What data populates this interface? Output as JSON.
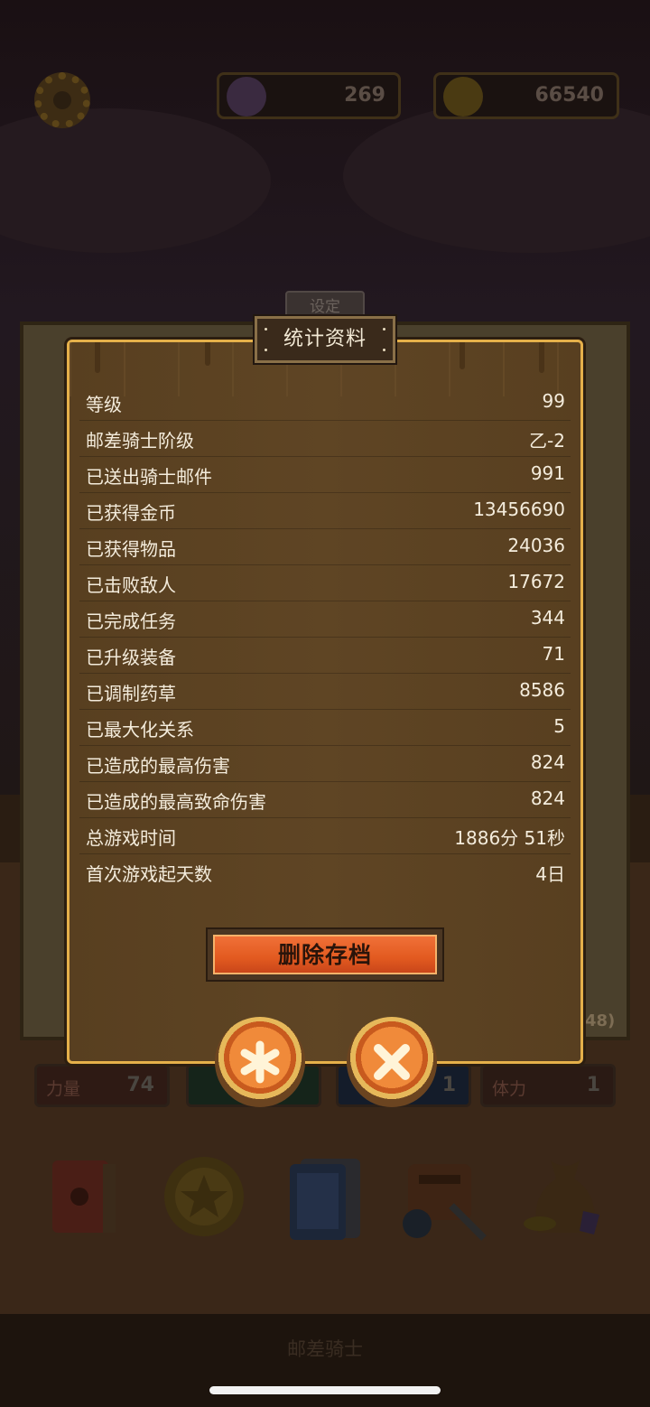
{
  "header": {
    "gem_count": "269",
    "coin_count": "66540"
  },
  "background": {
    "settings_tab_label": "设定",
    "partial_value": "48)",
    "attributes": [
      {
        "label": "力量",
        "value": "74",
        "color": "#5a2a20"
      },
      {
        "label": "",
        "value": "",
        "color": "#1f3e2a"
      },
      {
        "label": "",
        "value": "1",
        "color": "#1e2f4a"
      },
      {
        "label": "体力",
        "value": "1",
        "color": "#4a2a1e"
      }
    ],
    "bottom_icons": [
      "book-icon",
      "star-coin-icon",
      "card-deck-icon",
      "backpack-icon",
      "treasure-bag-icon"
    ],
    "bottom_label": "邮差骑士"
  },
  "modal": {
    "title": "统计资料",
    "stats": [
      {
        "label": "等级",
        "value": "99"
      },
      {
        "label": "邮差骑士阶级",
        "value": "乙-2"
      },
      {
        "label": "已送出骑士邮件",
        "value": "991"
      },
      {
        "label": "已获得金币",
        "value": "13456690"
      },
      {
        "label": "已获得物品",
        "value": "24036"
      },
      {
        "label": "已击败敌人",
        "value": "17672"
      },
      {
        "label": "已完成任务",
        "value": "344"
      },
      {
        "label": "已升级装备",
        "value": "71"
      },
      {
        "label": "已调制药草",
        "value": "8586"
      },
      {
        "label": "已最大化关系",
        "value": "5"
      },
      {
        "label": "已造成的最高伤害",
        "value": "824"
      },
      {
        "label": "已造成的最高致命伤害",
        "value": "824"
      },
      {
        "label": "总游戏时间",
        "value": "1886分 51秒"
      },
      {
        "label": "首次游戏起天数",
        "value": "4日"
      }
    ],
    "delete_button_label": "删除存档"
  }
}
